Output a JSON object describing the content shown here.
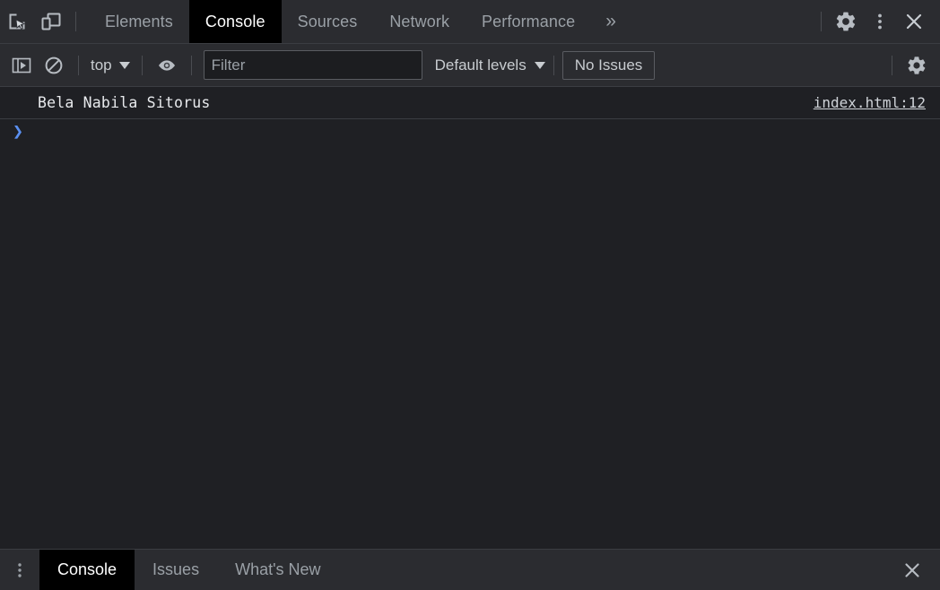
{
  "toolbar": {
    "inspect_icon": "inspect-cursor-icon",
    "device_icon": "device-toggle-icon",
    "tabs": [
      {
        "label": "Elements",
        "active": false
      },
      {
        "label": "Console",
        "active": true
      },
      {
        "label": "Sources",
        "active": false
      },
      {
        "label": "Network",
        "active": false
      },
      {
        "label": "Performance",
        "active": false
      }
    ],
    "more_tabs_label": "»",
    "settings_icon": "gear-icon",
    "menu_icon": "kebab-menu-icon",
    "close_icon": "close-icon"
  },
  "filterbar": {
    "sidebar_toggle_icon": "console-sidebar-icon",
    "clear_icon": "clear-console-icon",
    "context": "top",
    "eye_icon": "live-expression-eye-icon",
    "filter_placeholder": "Filter",
    "filter_value": "",
    "levels": "Default levels",
    "issues_label": "No Issues",
    "settings_icon": "gear-icon"
  },
  "console": {
    "messages": [
      {
        "text": "Bela Nabila Sitorus",
        "source": "index.html:12"
      }
    ],
    "prompt_symbol": "❯",
    "prompt_value": ""
  },
  "drawer": {
    "menu_icon": "kebab-menu-icon",
    "tabs": [
      {
        "label": "Console",
        "active": true
      },
      {
        "label": "Issues",
        "active": false
      },
      {
        "label": "What's New",
        "active": false
      }
    ],
    "close_icon": "close-icon"
  },
  "colors": {
    "panel_bg": "#2b2c30",
    "body_bg": "#1f2024",
    "active_tab_bg": "#000000",
    "text_primary": "#e8eaed",
    "text_muted": "#9aa0a6",
    "prompt_blue": "#5a8ff0",
    "border": "#3b3d42"
  }
}
